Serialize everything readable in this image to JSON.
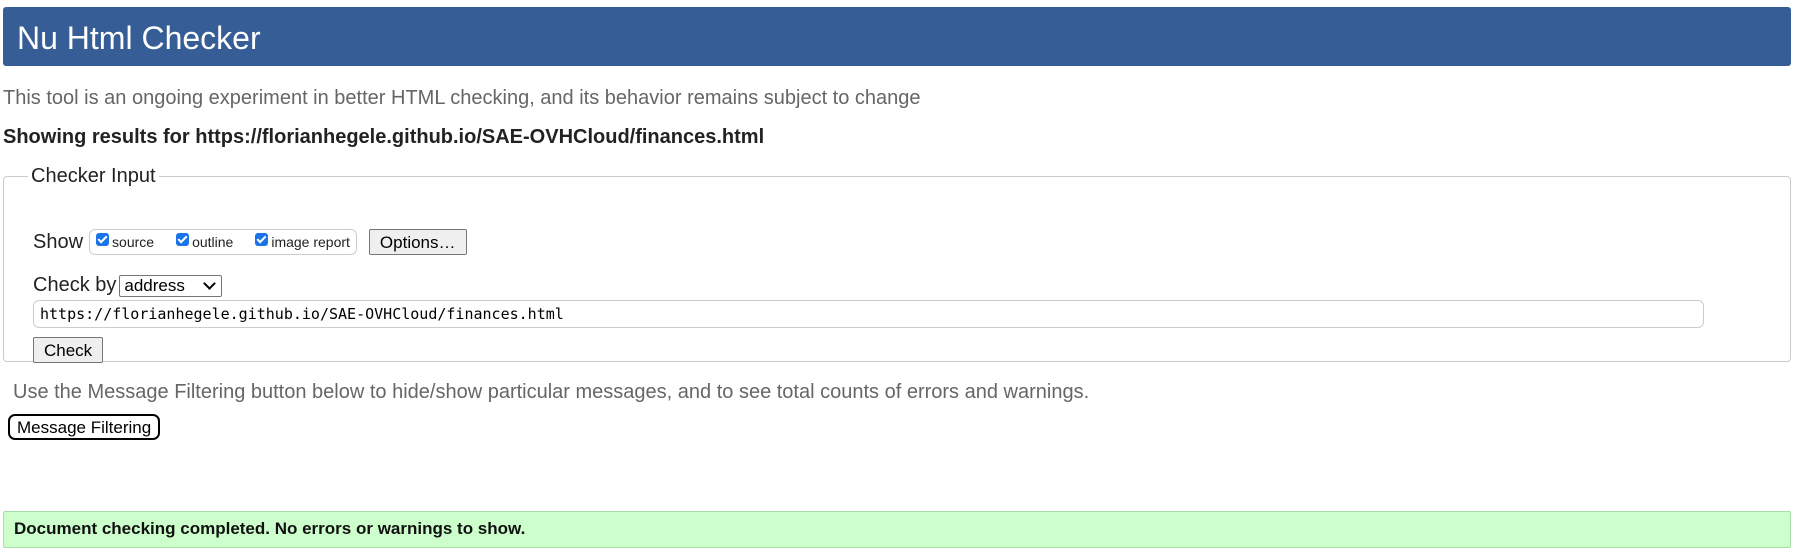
{
  "header": {
    "title": "Nu Html Checker"
  },
  "intro": "This tool is an ongoing experiment in better HTML checking, and its behavior remains subject to change",
  "showing_results": "Showing results for https://florianhegele.github.io/SAE-OVHCloud/finances.html",
  "checker_input": {
    "legend": "Checker Input",
    "show_label": "Show",
    "show_options": [
      {
        "label": "source",
        "checked": true
      },
      {
        "label": "outline",
        "checked": true
      },
      {
        "label": "image report",
        "checked": true
      }
    ],
    "options_button": "Options…",
    "check_by_label": "Check by",
    "check_by_selected": "address",
    "url_value": "https://florianhegele.github.io/SAE-OVHCloud/finances.html",
    "check_button": "Check"
  },
  "filter_note": "Use the Message Filtering button below to hide/show particular messages, and to see total counts of errors and warnings.",
  "filter_button": "Message Filtering",
  "result_message": "Document checking completed. No errors or warnings to show.",
  "colors": {
    "header_bg": "#365d95",
    "success_bg": "#ccffcc",
    "checkbox": "#1a73e8"
  }
}
